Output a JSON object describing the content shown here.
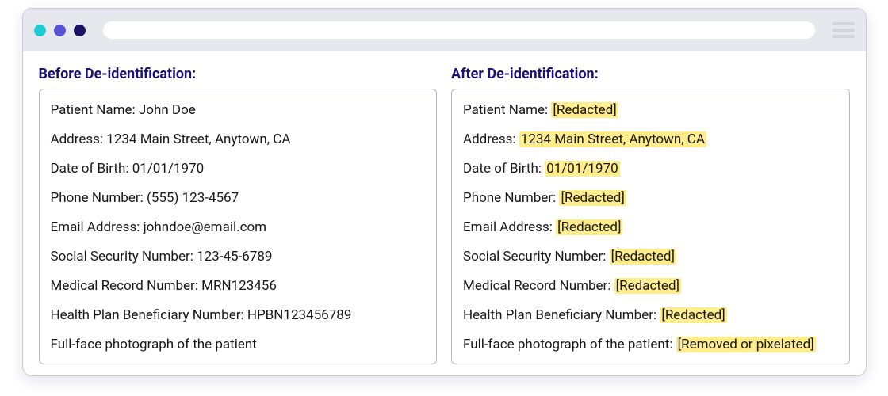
{
  "before": {
    "title": "Before De-identification:",
    "rows": [
      {
        "label": "Patient Name: ",
        "value": "John Doe"
      },
      {
        "label": "Address: ",
        "value": "1234 Main Street, Anytown, CA"
      },
      {
        "label": "Date of Birth: ",
        "value": "01/01/1970"
      },
      {
        "label": "Phone Number: ",
        "value": "(555) 123-4567"
      },
      {
        "label": "Email Address: ",
        "value": "johndoe@email.com"
      },
      {
        "label": "Social Security Number: ",
        "value": "123-45-6789"
      },
      {
        "label": "Medical Record Number: ",
        "value": "MRN123456"
      },
      {
        "label": "Health Plan Beneficiary Number: ",
        "value": "HPBN123456789"
      },
      {
        "label": "Full-face photograph of the patient",
        "value": ""
      }
    ]
  },
  "after": {
    "title": "After De-identification:",
    "rows": [
      {
        "label": "Patient Name: ",
        "value": "[Redacted]"
      },
      {
        "label": "Address: ",
        "value": "1234 Main Street, Anytown, CA"
      },
      {
        "label": "Date of Birth: ",
        "value": "01/01/1970"
      },
      {
        "label": "Phone Number: ",
        "value": "[Redacted]"
      },
      {
        "label": "Email Address: ",
        "value": "[Redacted]"
      },
      {
        "label": "Social Security Number: ",
        "value": "[Redacted]"
      },
      {
        "label": "Medical Record Number: ",
        "value": "[Redacted]"
      },
      {
        "label": "Health Plan Beneficiary Number: ",
        "value": "[Redacted]"
      },
      {
        "label": "Full-face photograph of the patient: ",
        "value": "[Removed or pixelated]"
      }
    ]
  }
}
